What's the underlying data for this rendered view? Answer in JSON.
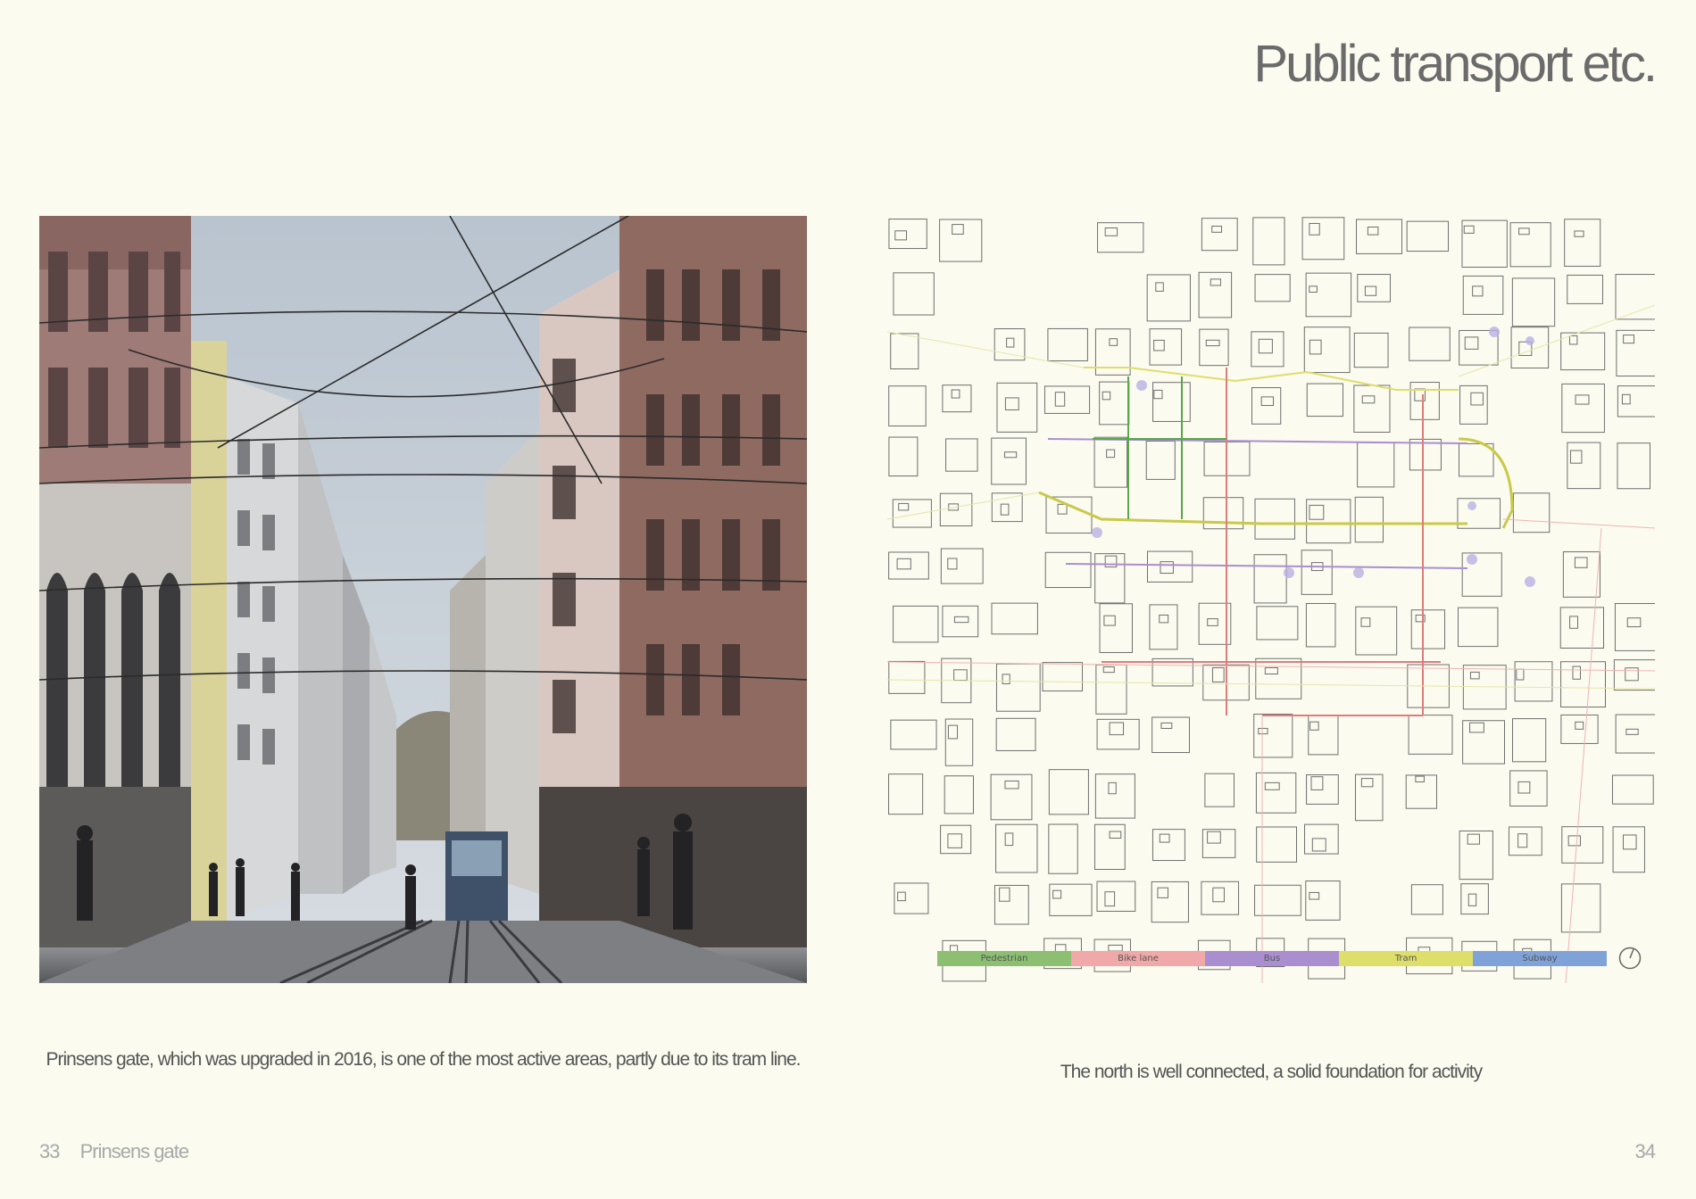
{
  "page": {
    "title": "Public transport etc.",
    "left_caption": "Prinsens gate, which was upgraded in 2016, is one of the most active areas, partly due to its tram line.",
    "right_caption": "The north is well connected, a solid foundation for activity",
    "footer_left_number": "33",
    "footer_left_section": "Prinsens gate",
    "footer_right_number": "34"
  },
  "legend": {
    "items": [
      {
        "label": "Pedestrian",
        "color": "#8cbf72"
      },
      {
        "label": "Bike lane",
        "color": "#f0a8a8"
      },
      {
        "label": "Bus",
        "color": "#a98fcf"
      },
      {
        "label": "Tram",
        "color": "#dede6a"
      },
      {
        "label": "Subway",
        "color": "#7fa2d9"
      }
    ]
  }
}
